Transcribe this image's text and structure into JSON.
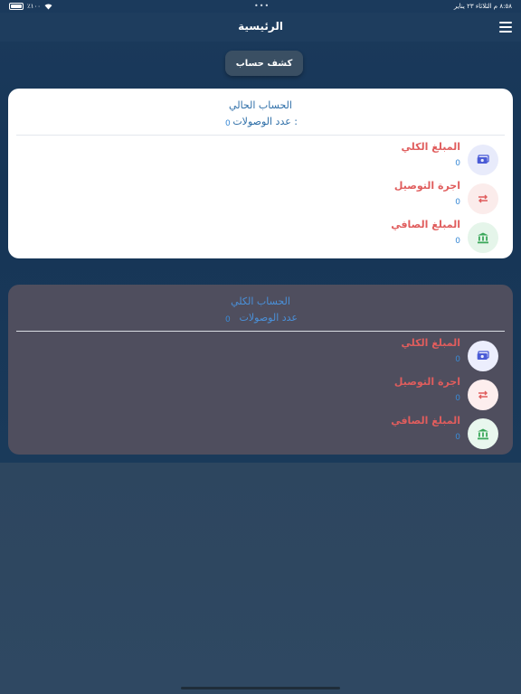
{
  "status": {
    "time": "٨:٥٨ م   الثلاثاء ٢٣ يناير",
    "battery": "٪١٠٠"
  },
  "nav": {
    "title": "الرئيسية"
  },
  "statement_button": "كشف حساب",
  "current_account": {
    "title": "الحساب الحالي",
    "receipts_label": "عدد الوصولات :",
    "receipts_value": "0",
    "rows": [
      {
        "label": "المبلغ الكلي",
        "value": "0",
        "icon": "money-icon"
      },
      {
        "label": "اجرة التوصيل",
        "value": "0",
        "icon": "swap-arrows-icon"
      },
      {
        "label": "المبلغ الصافي",
        "value": "0",
        "icon": "bank-icon"
      }
    ]
  },
  "total_account": {
    "title": "الحساب الكلي",
    "receipts_label": "عدد الوصولات",
    "receipts_value": "0",
    "rows": [
      {
        "label": "المبلغ الكلي",
        "value": "0",
        "icon": "money-icon"
      },
      {
        "label": "اجرة التوصيل",
        "value": "0",
        "icon": "swap-arrows-icon"
      },
      {
        "label": "المبلغ الصافي",
        "value": "0",
        "icon": "bank-icon"
      }
    ]
  },
  "colors": {
    "label_red": "#e05d5d",
    "value_blue": "#3a8ad6",
    "title_blue": "#2f6fa8",
    "money_icon": "#4a5bd6",
    "swap_icon": "#e05d5d",
    "bank_icon": "#3aa75a"
  }
}
